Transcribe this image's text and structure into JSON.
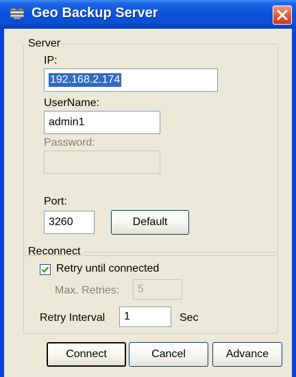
{
  "window": {
    "title": "Geo Backup Server"
  },
  "server": {
    "legend": "Server",
    "ip_label": "IP:",
    "ip_value": "192.168.2.174",
    "username_label": "UserName:",
    "username_value": "admin1",
    "password_label": "Password:",
    "password_value": "",
    "port_label": "Port:",
    "port_value": "3260",
    "default_label": "Default"
  },
  "reconnect": {
    "legend": "Reconnect",
    "retry_label": "Retry until connected",
    "retry_checked": true,
    "max_retries_label": "Max. Retries:",
    "max_retries_value": "5",
    "retry_interval_label": "Retry Interval",
    "retry_interval_value": "1",
    "unit_label": "Sec"
  },
  "buttons": {
    "connect": "Connect",
    "cancel": "Cancel",
    "advance": "Advance"
  },
  "colors": {
    "titlebar": "#0a52dc",
    "dialog_bg": "#ece9d8",
    "selection": "#316ac5",
    "close_button": "#e2563a"
  },
  "icons": {
    "title": "server-icon",
    "close": "close-icon",
    "check": "checkmark-icon"
  }
}
